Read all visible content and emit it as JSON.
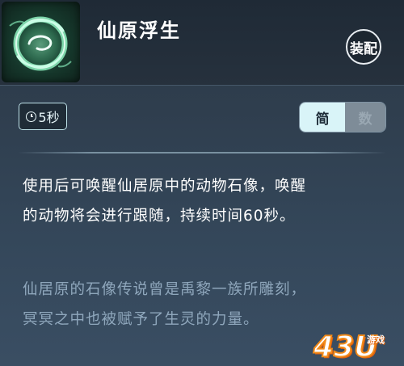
{
  "skill": {
    "name": "仙原浮生",
    "icon": "swirl-ring-icon",
    "equip_label": "装配"
  },
  "cooldown": {
    "icon": "clock-icon",
    "label": "5秒"
  },
  "mode_toggle": {
    "active_label": "简",
    "inactive_label": "数"
  },
  "description": {
    "line1": "使用后可唤醒仙居原中的动物石像，唤醒",
    "line2": "的动物将会进行跟随，持续时间60秒。"
  },
  "lore": {
    "line1": "仙居原的石像传说曾是禹黎一族所雕刻，",
    "line2": "冥冥之中也被赋予了生灵的力量。"
  },
  "watermark": {
    "main": "43U",
    "sub": "游戏"
  },
  "colors": {
    "accent": "#d9f4f8",
    "lore_text": "#8fa7bc",
    "watermark_stroke": "#f28b1a"
  }
}
